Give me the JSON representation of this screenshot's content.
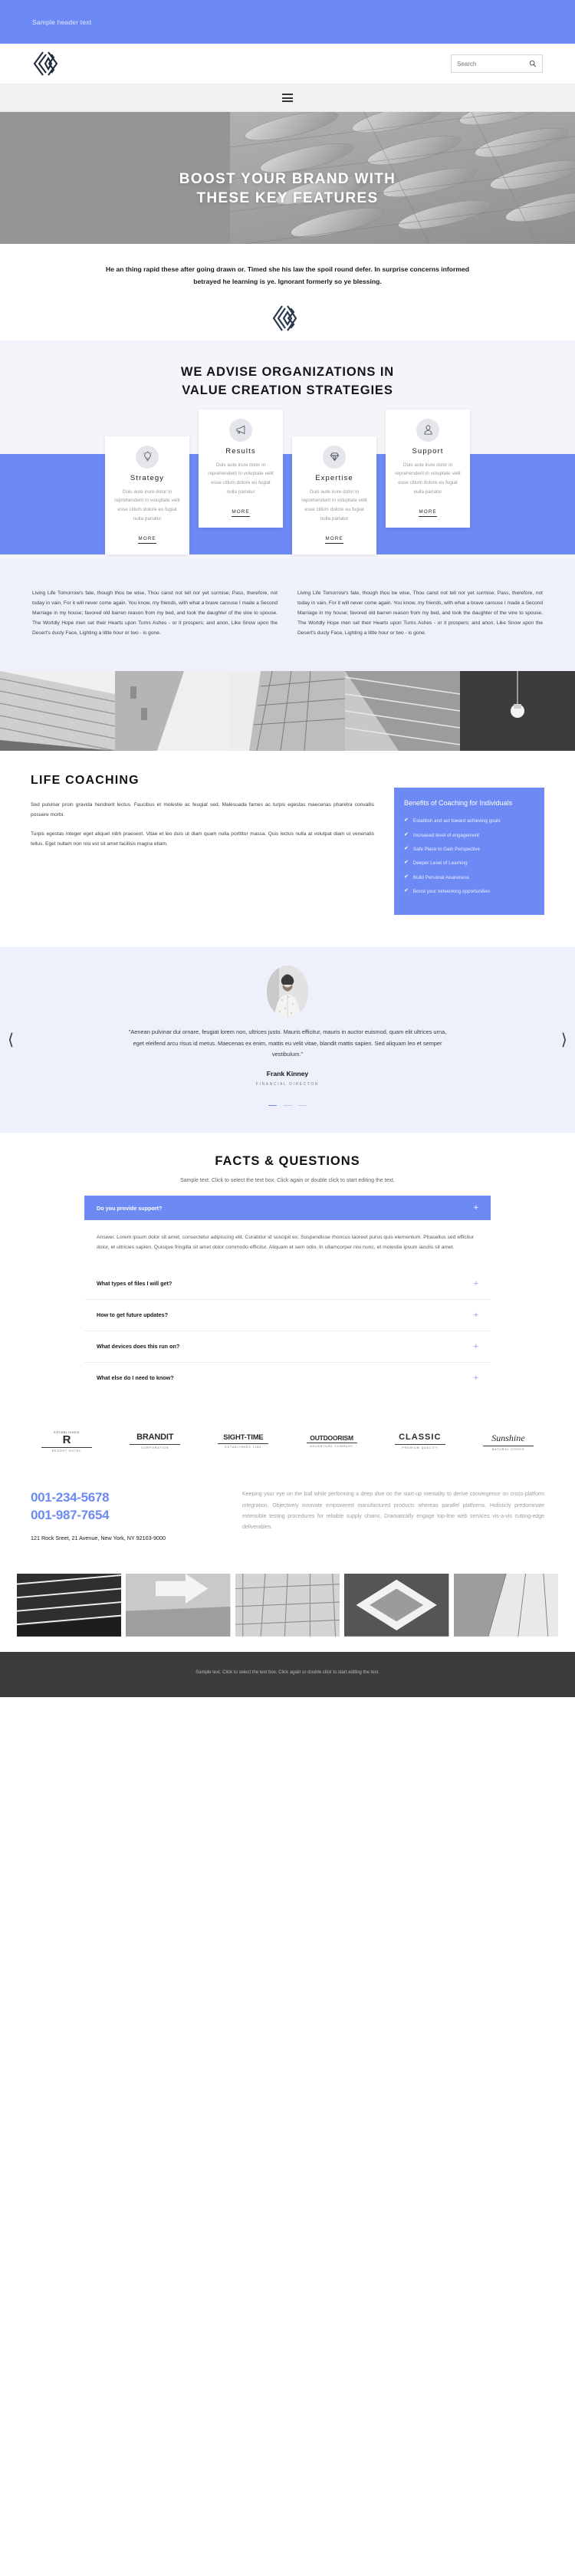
{
  "topbar": {
    "text": "Sample header text"
  },
  "header": {
    "logo_name": "brand-logo",
    "search_placeholder": "Search",
    "search_value": ""
  },
  "nav": {
    "menu_label": "Menu"
  },
  "hero": {
    "title_line1": "BOOST YOUR BRAND WITH",
    "title_line2": "THESE KEY FEATURES"
  },
  "intro": {
    "text": "He an thing rapid these after going drawn or. Timed she his law the spoil round defer. In surprise concerns informed betrayed he learning is ye. Ignorant formerly so ye blessing."
  },
  "services": {
    "heading_line1": "WE ADVISE ORGANIZATIONS IN",
    "heading_line2": "VALUE CREATION STRATEGIES",
    "cards": [
      {
        "icon": "lightbulb-icon",
        "title": "Strategy",
        "text": "Duis aute irure dolor in reprehenderit in voluptate velit esse cillum dolore eu fugiat nulla pariatur",
        "more": "MORE"
      },
      {
        "icon": "megaphone-icon",
        "title": "Results",
        "text": "Duis aute irure dolor in reprehenderit in voluptate velit esse cillum dolore eu fugiat nulla pariatur",
        "more": "MORE"
      },
      {
        "icon": "diamond-icon",
        "title": "Expertise",
        "text": "Duis aute irure dolor in reprehenderit in voluptate velit esse cillum dolore eu fugiat nulla pariatur",
        "more": "MORE"
      },
      {
        "icon": "user-icon",
        "title": "Support",
        "text": "Duis aute irure dolor in reprehenderit in voluptate velit esse cillum dolore eu fugiat nulla pariatur",
        "more": "MORE"
      }
    ]
  },
  "twocol": {
    "left": "Living Life Tomorrow's fate, though thou be wise, Thou canst not tell nor yet surmise; Pass, therefore, not today in vain, For it will never come again. You know, my friends, with what a brave carouse I made a Second Marriage in my house; favored old barren reason from my bed, and took the daughter of the vine to spouse. The Worldly Hope men set their Hearts upon Turns Ashes - or it prospers; and anon, Like Snow upon the Desert's dusty Face, Lighting a little hour or two - is gone.",
    "right": "Living Life Tomorrow's fate, though thou be wise, Thou canst not tell nor yet surmise; Pass, therefore, not today in vain, For it will never come again. You know, my friends, with what a brave carouse I made a Second Marriage in my house; favored old barren reason from my bed, and took the daughter of the vine to spouse. The Worldly Hope men set their Hearts upon Turns Ashes - or it prospers; and anon, Like Snow upon the Desert's dusty Face, Lighting a little hour or two - is gone."
  },
  "coaching": {
    "title": "LIFE COACHING",
    "paragraph1": "Sed pulvinar proin gravida hendrerit lectus. Faucibus et molestie ac feugiat sed. Malesuada fames ac turpis egestas maecenas pharetra convallis posuere morbi.",
    "paragraph2": "Turpis egestas integer eget aliquet nibh praesent. Vitae et leo duis ut diam quam nulla porttitor massa. Quis lectus nulla at volutpat diam ut venenatis tellus. Eget nullam non nisi est sit amet facilisis magna etiam.",
    "benefits_title": "Benefits of Coaching for Individuals",
    "benefits": [
      "Establish and act toward achieving goals",
      "Increased level of engagement",
      "Safe Place to Gain Perspective",
      "Deeper Level of Learning",
      "Build Personal Awareness",
      "Boost your networking opportunities"
    ]
  },
  "testimonial": {
    "quote": "\"Aenean pulvinar dui ornare, feugiat lorem non, ultrices justo. Mauris efficitur, mauris in auctor euismod, quam elit ultrices urna, eget eleifend arcu risus id metus. Maecenas ex enim, mattis eu velit vitae, blandit mattis sapien. Sed aliquam leo et semper vestibulum.\"",
    "name": "Frank Kinney",
    "role": "FINANCIAL DIRECTOR",
    "prev_icon": "chevron-left-icon",
    "next_icon": "chevron-right-icon"
  },
  "faq": {
    "title": "FACTS & QUESTIONS",
    "subtitle": "Sample text. Click to select the text box. Click again or double click to start editing the text.",
    "open_question": "Do you provide support?",
    "open_answer": "Answer. Lorem ipsum dolor sit amet, consectetur adipiscing elit. Curabitur id suscipit ex. Suspendisse rhoncus laoreet purus quis elementum. Phasellus sed efficitur dolor, et ultricies sapien. Quisque fringilla sit amet dolor commodo efficitur. Aliquam et sem odio. In ullamcorper nisi nunc, et molestie ipsum iaculis sit amet.",
    "items": [
      "What types of files I will get?",
      "How to get future updates?",
      "What devices does this run on?",
      "What else do I need to know?"
    ],
    "plus_icon": "plus-icon"
  },
  "brands": [
    {
      "top": "ESTABLISHED",
      "main": "R",
      "sub": "RESORT HOTEL"
    },
    {
      "top": "",
      "main": "BRANDIT",
      "sub": "CORPORATION"
    },
    {
      "top": "",
      "main": "SIGHT-TIME",
      "sub": "ESTABLISHED 1984"
    },
    {
      "top": "",
      "main": "OUTDOORISM",
      "sub": "ADVENTURE COMPANY"
    },
    {
      "top": "",
      "main": "CLASSIC",
      "sub": "PREMIUM QUALITY"
    },
    {
      "top": "",
      "main": "Sunshine",
      "sub": "NATURAL GOODS"
    }
  ],
  "contact": {
    "phone1": "001-234-5678",
    "phone2": "001-987-7654",
    "address": "121 Rock Sreet, 21 Avenue, New York, NY 92103-9000",
    "text": "Keeping your eye on the ball while performing a deep dive on the start-up mentality to derive convergence on cross-platform integration. Objectively innovate empowered manufactured products whereas parallel platforms. Holisticly predominate extensible testing procedures for reliable supply chains. Dramatically engage top-line web services vis-a-vis cutting-edge deliverables."
  },
  "footer": {
    "text": "Sample text. Click to select the text box. Click again or double click to start editing the text."
  }
}
